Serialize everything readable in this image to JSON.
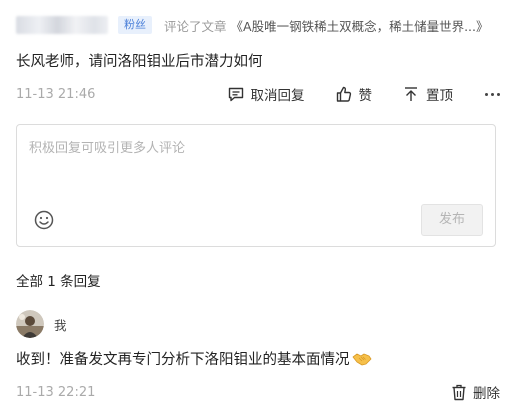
{
  "comment": {
    "author_badge": "粉丝",
    "commented_on_label": "评论了文章",
    "article_title": "《A股唯一钢铁稀土双概念，稀土储量世界...",
    "article_title_end": "》",
    "text": "长风老师，请问洛阳钼业后市潜力如何",
    "timestamp": "11-13 21:46",
    "actions": {
      "cancel_reply": "取消回复",
      "like": "赞",
      "pin": "置顶"
    }
  },
  "reply_box": {
    "placeholder": "积极回复可吸引更多人评论",
    "publish_label": "发布"
  },
  "replies": {
    "count_label": "全部 1 条回复",
    "items": [
      {
        "author": "我",
        "text": "收到！准备发文再专门分析下洛阳钼业的基本面情况",
        "emoji": "handshake-emoji",
        "timestamp": "11-13 22:21",
        "delete_label": "删除"
      }
    ]
  },
  "colors": {
    "badge_bg": "#e8f0fc",
    "badge_text": "#4a7fd8",
    "muted_text": "#aaaaaa",
    "publish_disabled_bg": "#f2f2f2"
  },
  "icons": [
    "comment-icon",
    "thumbs-up-icon",
    "pin-top-icon",
    "more-icon",
    "emoji-icon",
    "trash-icon",
    "handshake-emoji"
  ]
}
